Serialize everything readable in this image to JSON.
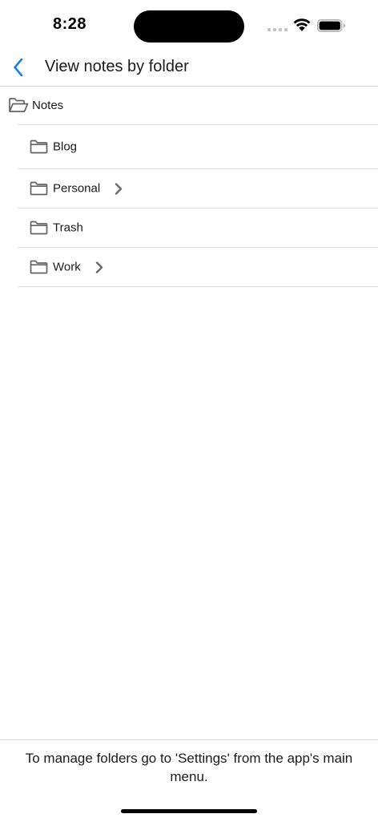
{
  "status_bar": {
    "time": "8:28"
  },
  "nav": {
    "title": "View notes by folder",
    "back_icon": "chevron-left-icon",
    "accent_color": "#1a7fe0"
  },
  "root_folder": {
    "label": "Notes",
    "icon": "folder-open-icon"
  },
  "folders": [
    {
      "label": "Blog",
      "icon": "folder-icon",
      "has_children": false
    },
    {
      "label": "Personal",
      "icon": "folder-icon",
      "has_children": true
    },
    {
      "label": "Trash",
      "icon": "folder-icon",
      "has_children": false
    },
    {
      "label": "Work",
      "icon": "folder-icon",
      "has_children": true
    }
  ],
  "footer": {
    "text": "To manage folders go to 'Settings' from the app's main menu."
  }
}
